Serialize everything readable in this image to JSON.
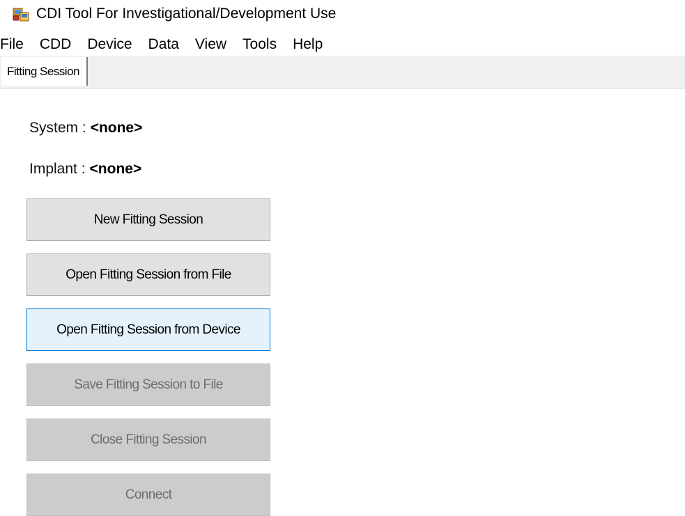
{
  "window": {
    "title": "CDI Tool For Investigational/Development Use",
    "icon": "app-window-icon"
  },
  "menu": {
    "items": [
      "File",
      "CDD",
      "Device",
      "Data",
      "View",
      "Tools",
      "Help"
    ]
  },
  "tabs": [
    {
      "label": "Fitting Session",
      "selected": true
    }
  ],
  "info": {
    "system_label": "System :",
    "system_value": "<none>",
    "implant_label": "Implant :",
    "implant_value": "<none>"
  },
  "buttons": [
    {
      "label": "New Fitting Session",
      "state": "enabled"
    },
    {
      "label": "Open Fitting Session from File",
      "state": "enabled"
    },
    {
      "label": "Open Fitting Session from Device",
      "state": "focused"
    },
    {
      "label": "Save Fitting Session to File",
      "state": "disabled"
    },
    {
      "label": "Close Fitting Session",
      "state": "disabled"
    },
    {
      "label": "Connect",
      "state": "disabled"
    }
  ],
  "colors": {
    "button_face": "#e1e1e1",
    "button_focus_border": "#0078d7",
    "button_focus_face": "#e5f1fb",
    "button_disabled_face": "#cccccc",
    "button_disabled_text": "#6d6d6d",
    "tab_strip": "#f0f0f0"
  }
}
